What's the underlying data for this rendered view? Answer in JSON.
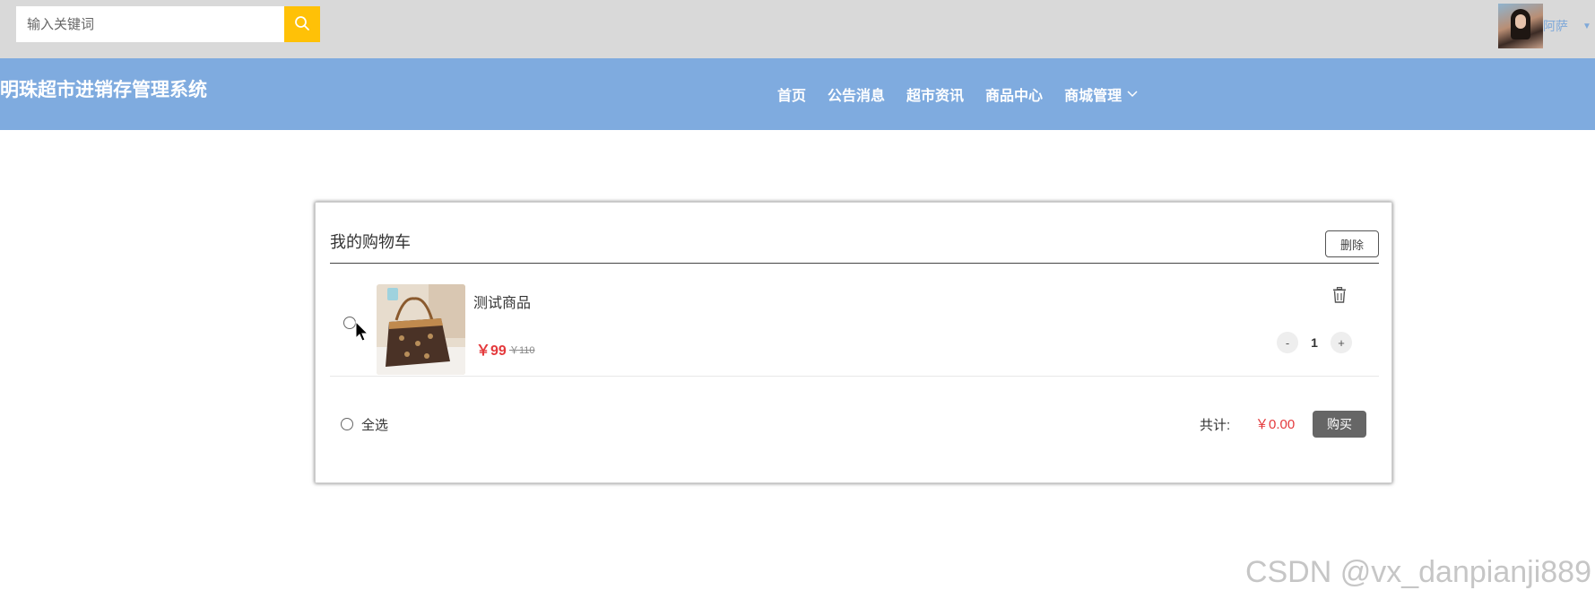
{
  "search": {
    "placeholder": "输入关键词",
    "icon": "search-icon"
  },
  "user": {
    "name": "阿萨",
    "avatar_icon": "user-avatar",
    "caret_icon": "caret-down-icon"
  },
  "brand": {
    "title": "明珠超市进销存管理系统"
  },
  "nav": {
    "items": [
      {
        "label": "首页"
      },
      {
        "label": "公告消息"
      },
      {
        "label": "超市资讯"
      },
      {
        "label": "商品中心"
      },
      {
        "label": "商城管理",
        "icon": "chevron-down-icon"
      }
    ]
  },
  "cart": {
    "title": "我的购物车",
    "delete_label": "删除",
    "items": [
      {
        "name": "测试商品",
        "price": "￥99",
        "original_price": "￥110",
        "quantity": "1",
        "minus_label": "-",
        "plus_label": "+",
        "trash_icon": "trash-icon",
        "selected": false
      }
    ],
    "footer": {
      "select_all_label": "全选",
      "total_label": "共计:",
      "total_value": "￥0.00",
      "buy_label": "购买"
    }
  },
  "watermark": "CSDN @vx_danpianji889",
  "colors": {
    "topbar_bg": "#d9d9d9",
    "navbar_bg": "#7fabdf",
    "search_button": "#ffc107",
    "price_red": "#e4393c",
    "buy_button": "#666666"
  }
}
